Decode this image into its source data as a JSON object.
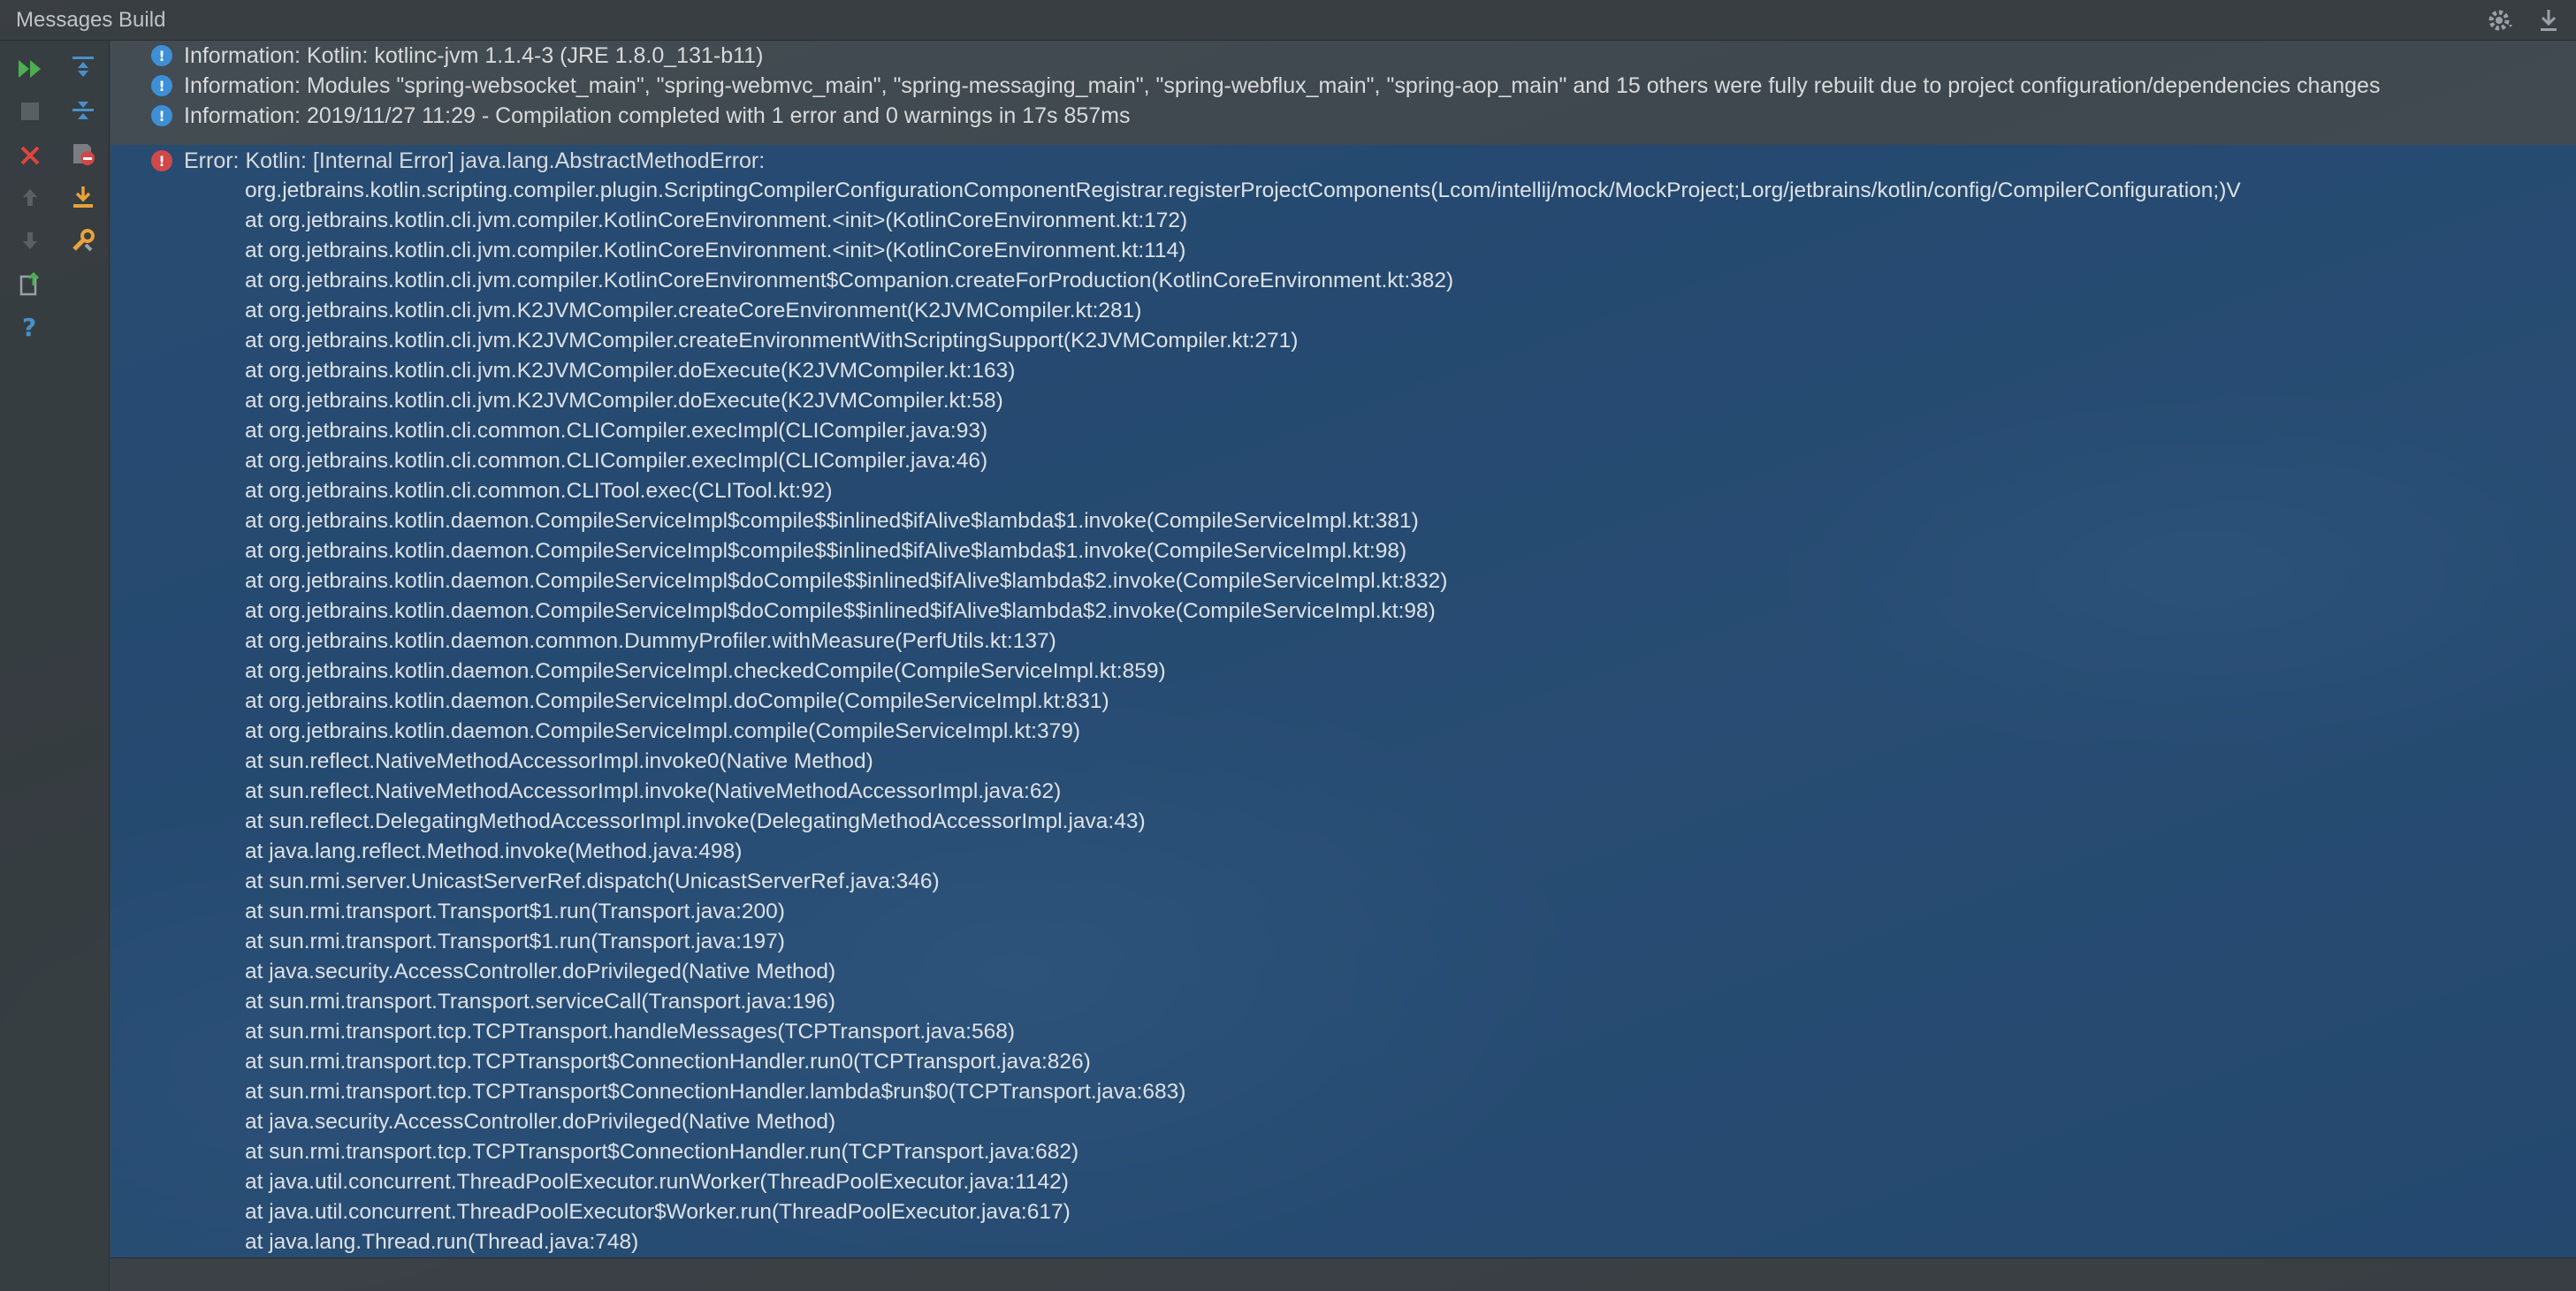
{
  "window": {
    "title": "Messages Build",
    "right_icons": [
      "gear-icon",
      "download-icon"
    ]
  },
  "toolbar": {
    "tools": [
      {
        "name": "rerun-icon"
      },
      {
        "name": "expand-all-icon"
      },
      {
        "name": "stop-icon"
      },
      {
        "name": "collapse-all-icon"
      },
      {
        "name": "close-icon"
      },
      {
        "name": "show-errors-icon"
      },
      {
        "name": "previous-occurrence-icon"
      },
      {
        "name": "export-icon"
      },
      {
        "name": "next-occurrence-icon"
      },
      {
        "name": "settings-wrench-icon"
      },
      {
        "name": "export-to-file-icon"
      },
      {
        "name": "help-icon"
      }
    ]
  },
  "messages": [
    {
      "type": "info",
      "text": "Information: Kotlin: kotlinc-jvm 1.1.4-3 (JRE 1.8.0_131-b11)"
    },
    {
      "type": "info",
      "text": "Information: Modules \"spring-websocket_main\", \"spring-webmvc_main\", \"spring-messaging_main\", \"spring-webflux_main\", \"spring-aop_main\" and 15 others were fully rebuilt due to project configuration/dependencies changes"
    },
    {
      "type": "info",
      "text": "Information: 2019/11/27 11:29 - Compilation completed with 1 error and 0 warnings in 17s 857ms"
    }
  ],
  "error": {
    "header": "Error: Kotlin: [Internal Error] java.lang.AbstractMethodError:",
    "stack": [
      "org.jetbrains.kotlin.scripting.compiler.plugin.ScriptingCompilerConfigurationComponentRegistrar.registerProjectComponents(Lcom/intellij/mock/MockProject;Lorg/jetbrains/kotlin/config/CompilerConfiguration;)V",
      "at org.jetbrains.kotlin.cli.jvm.compiler.KotlinCoreEnvironment.<init>(KotlinCoreEnvironment.kt:172)",
      "at org.jetbrains.kotlin.cli.jvm.compiler.KotlinCoreEnvironment.<init>(KotlinCoreEnvironment.kt:114)",
      "at org.jetbrains.kotlin.cli.jvm.compiler.KotlinCoreEnvironment$Companion.createForProduction(KotlinCoreEnvironment.kt:382)",
      "at org.jetbrains.kotlin.cli.jvm.K2JVMCompiler.createCoreEnvironment(K2JVMCompiler.kt:281)",
      "at org.jetbrains.kotlin.cli.jvm.K2JVMCompiler.createEnvironmentWithScriptingSupport(K2JVMCompiler.kt:271)",
      "at org.jetbrains.kotlin.cli.jvm.K2JVMCompiler.doExecute(K2JVMCompiler.kt:163)",
      "at org.jetbrains.kotlin.cli.jvm.K2JVMCompiler.doExecute(K2JVMCompiler.kt:58)",
      "at org.jetbrains.kotlin.cli.common.CLICompiler.execImpl(CLICompiler.java:93)",
      "at org.jetbrains.kotlin.cli.common.CLICompiler.execImpl(CLICompiler.java:46)",
      "at org.jetbrains.kotlin.cli.common.CLITool.exec(CLITool.kt:92)",
      "at org.jetbrains.kotlin.daemon.CompileServiceImpl$compile$$inlined$ifAlive$lambda$1.invoke(CompileServiceImpl.kt:381)",
      "at org.jetbrains.kotlin.daemon.CompileServiceImpl$compile$$inlined$ifAlive$lambda$1.invoke(CompileServiceImpl.kt:98)",
      "at org.jetbrains.kotlin.daemon.CompileServiceImpl$doCompile$$inlined$ifAlive$lambda$2.invoke(CompileServiceImpl.kt:832)",
      "at org.jetbrains.kotlin.daemon.CompileServiceImpl$doCompile$$inlined$ifAlive$lambda$2.invoke(CompileServiceImpl.kt:98)",
      "at org.jetbrains.kotlin.daemon.common.DummyProfiler.withMeasure(PerfUtils.kt:137)",
      "at org.jetbrains.kotlin.daemon.CompileServiceImpl.checkedCompile(CompileServiceImpl.kt:859)",
      "at org.jetbrains.kotlin.daemon.CompileServiceImpl.doCompile(CompileServiceImpl.kt:831)",
      "at org.jetbrains.kotlin.daemon.CompileServiceImpl.compile(CompileServiceImpl.kt:379)",
      "at sun.reflect.NativeMethodAccessorImpl.invoke0(Native Method)",
      "at sun.reflect.NativeMethodAccessorImpl.invoke(NativeMethodAccessorImpl.java:62)",
      "at sun.reflect.DelegatingMethodAccessorImpl.invoke(DelegatingMethodAccessorImpl.java:43)",
      "at java.lang.reflect.Method.invoke(Method.java:498)",
      "at sun.rmi.server.UnicastServerRef.dispatch(UnicastServerRef.java:346)",
      "at sun.rmi.transport.Transport$1.run(Transport.java:200)",
      "at sun.rmi.transport.Transport$1.run(Transport.java:197)",
      "at java.security.AccessController.doPrivileged(Native Method)",
      "at sun.rmi.transport.Transport.serviceCall(Transport.java:196)",
      "at sun.rmi.transport.tcp.TCPTransport.handleMessages(TCPTransport.java:568)",
      "at sun.rmi.transport.tcp.TCPTransport$ConnectionHandler.run0(TCPTransport.java:826)",
      "at sun.rmi.transport.tcp.TCPTransport$ConnectionHandler.lambda$run$0(TCPTransport.java:683)",
      "at java.security.AccessController.doPrivileged(Native Method)",
      "at sun.rmi.transport.tcp.TCPTransport$ConnectionHandler.run(TCPTransport.java:682)",
      "at java.util.concurrent.ThreadPoolExecutor.runWorker(ThreadPoolExecutor.java:1142)",
      "at java.util.concurrent.ThreadPoolExecutor$Worker.run(ThreadPoolExecutor.java:617)",
      "at java.lang.Thread.run(Thread.java:748)"
    ]
  },
  "colors": {
    "info_icon": "#3d8fd6",
    "error_icon": "#d04848",
    "selection": "#214e80",
    "run_green": "#4caf50",
    "close_red": "#e0443e"
  }
}
